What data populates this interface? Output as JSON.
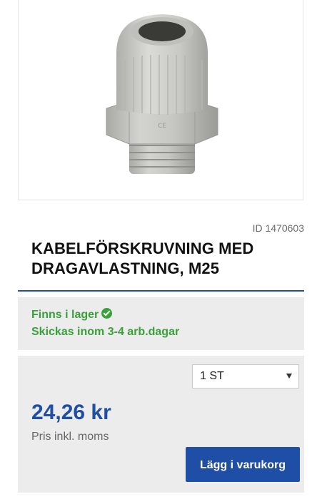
{
  "product": {
    "image_alt": "cable gland",
    "id_label": "ID 1470603",
    "title": "KABELFÖRSKRUVNING MED DRAGAVLASTNING, M25"
  },
  "stock": {
    "status": "Finns i lager",
    "status_icon": "check-circle-icon",
    "delivery": "Skickas inom 3-4 arb.dagar",
    "color": "#3aa03a"
  },
  "purchase": {
    "quantity_selected": "1 ST",
    "price": "24,26 kr",
    "price_note": "Pris inkl. moms",
    "add_to_cart_label": "Lägg i varukorg"
  },
  "theme": {
    "accent": "#1f4ea6",
    "panel_bg": "#ececec"
  }
}
